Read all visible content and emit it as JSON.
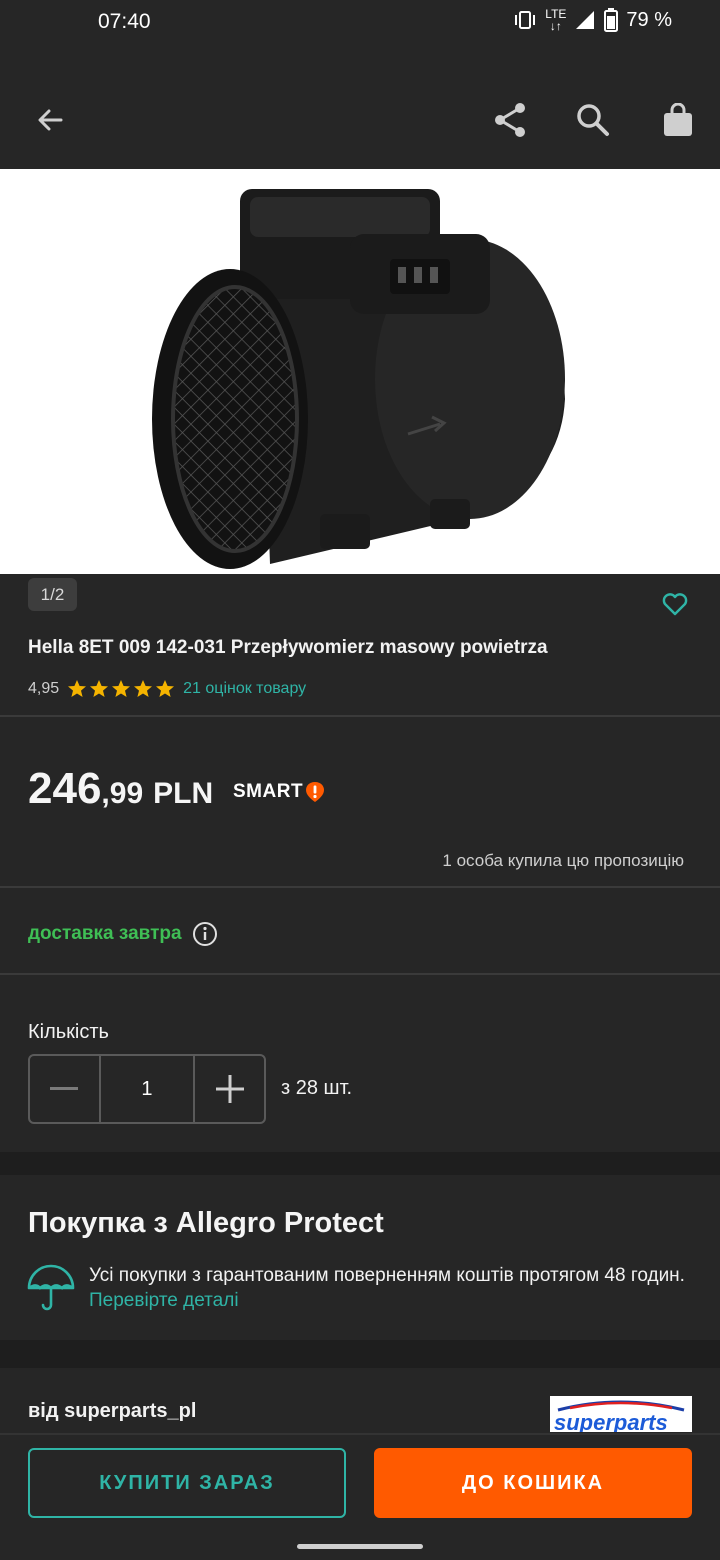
{
  "status_bar": {
    "time": "07:40",
    "network": "LTE",
    "battery": "79 %",
    "icons": [
      "vibrate-icon",
      "lte-icon",
      "signal-icon",
      "battery-icon"
    ]
  },
  "app_bar": {
    "icons": [
      "back-arrow-icon",
      "share-icon",
      "search-icon",
      "shopping-bag-icon"
    ]
  },
  "product": {
    "image_counter": "1/2",
    "title": "Hella 8ET 009 142-031 Przepływomierz masowy powietrza",
    "rating_value": "4,95",
    "rating_stars": 5,
    "rating_link": "21 оцінок товару",
    "price_int": "246",
    "price_dec": ",99",
    "currency": "PLN",
    "smart_label": "SMART",
    "buyers_text": "1 особа купила цю пропозицію",
    "delivery_text": "доставка завтра"
  },
  "quantity": {
    "label": "Кількість",
    "value": "1",
    "stock": "з 28 шт."
  },
  "protect": {
    "title": "Покупка з Allegro Protect",
    "text": "Усі покупки з гарантованим поверненням коштів протягом 48 годин.",
    "link": "Перевірте деталі"
  },
  "seller": {
    "label": "від superparts_pl",
    "logo_text": "superparts"
  },
  "actions": {
    "buy_now": "КУПИТИ ЗАРАЗ",
    "add_to_cart": "ДО КОШИКА"
  },
  "colors": {
    "background": "#262626",
    "accent_teal": "#2fb4a6",
    "accent_orange": "#ff5a00",
    "star": "#f5b400",
    "delivery_green": "#3fbf55"
  }
}
